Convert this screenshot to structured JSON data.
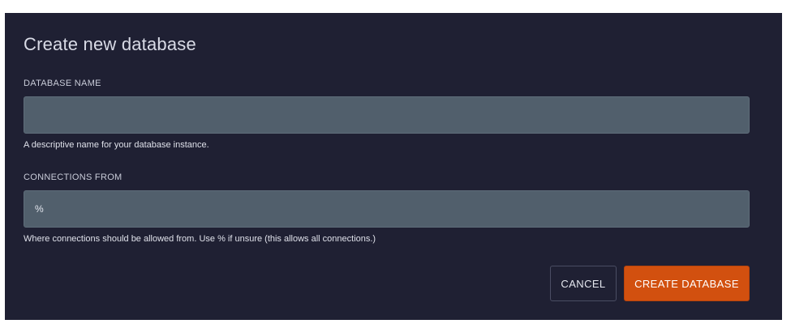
{
  "dialog": {
    "title": "Create new database"
  },
  "database_name": {
    "label": "DATABASE NAME",
    "value": "",
    "placeholder": "",
    "hint": "A descriptive name for your database instance."
  },
  "connections_from": {
    "label": "CONNECTIONS FROM",
    "value": "%",
    "hint": "Where connections should be allowed from. Use % if unsure (this allows all connections.)"
  },
  "actions": {
    "cancel_label": "CANCEL",
    "create_label": "CREATE DATABASE"
  },
  "colors": {
    "background": "#1f2033",
    "field": "#515f6c",
    "accent": "#d2500f"
  }
}
